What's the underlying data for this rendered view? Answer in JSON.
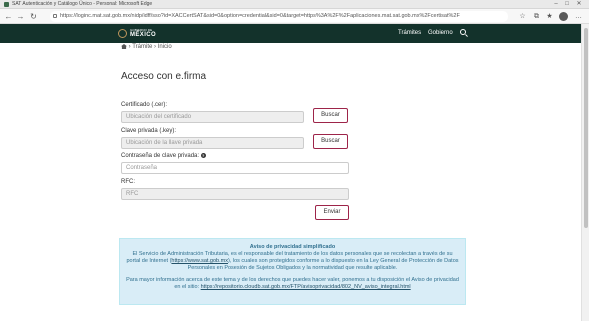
{
  "browser": {
    "tab_title": "SAT Autenticación y Catálogo Único - Personal: Microsoft Edge",
    "url": "https://loginc.mat.sat.gob.mx/nidp/idff/sso?id=XACCertSAT&sid=0&option=credential&sid=0&target=https%3A%2F%2Faplicaciones.mat.sat.gob.mx%2Fcertisat%2F",
    "minimize_icon": "minimize-icon",
    "maximize_icon": "maximize-icon",
    "close_icon": "close-icon"
  },
  "header": {
    "logo_small": "GOBIERNO DE",
    "logo_big": "MÉXICO",
    "menu": [
      "Trámites",
      "Gobierno"
    ],
    "search_icon": "search-icon",
    "background": "#13322b"
  },
  "breadcrumb": {
    "separator": " › ",
    "items": [
      "Trámite",
      "Inicio"
    ]
  },
  "form": {
    "title": "Acceso con e.firma",
    "certificado_label": "Certificado (.cer):",
    "certificado_placeholder": "Ubicación del certificado",
    "clave_label": "Clave privada (.key):",
    "clave_placeholder": "Ubicación de la llave privada",
    "password_label": "Contraseña de clave privada:",
    "password_help": "?",
    "password_placeholder": "Contraseña",
    "rfc_label": "RFC:",
    "rfc_placeholder": "RFC",
    "buscar_label": "Buscar",
    "enviar_label": "Enviar",
    "accent": "#9d2449"
  },
  "privacy": {
    "title": "Aviso de privacidad simplificado",
    "p1_a": "El Servicio de Administración Tributaria, es el responsable del tratamiento de los datos personales que se recolectan a través de su portal de Internet (",
    "p1_link": "https://www.sat.gob.mx",
    "p1_b": "), los cuales son protegidos conforme a lo dispuesto en la Ley General de Protección de Datos Personales en Posesión de Sujetos Obligados y la normatividad que resulte aplicable.",
    "p2_a": "Para mayor información acerca de este tema y de los derechos que puedes hacer valer, ponemos a tu disposición el Aviso de privacidad en el sitio: ",
    "p2_link": "https://repositorio.cloudb.sat.gob.mx/FTP/avisoprivacidad/802_NV_aviso_integral.html",
    "background": "#d9edf7"
  }
}
